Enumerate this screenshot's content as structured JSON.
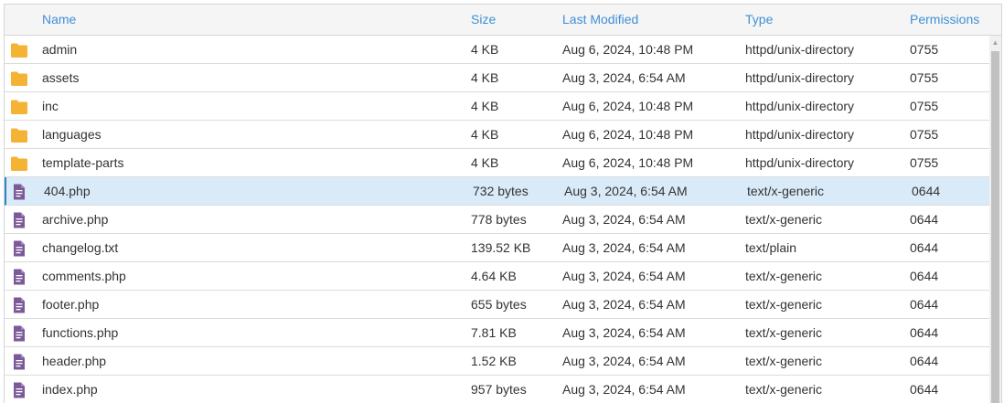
{
  "columns": {
    "name": "Name",
    "size": "Size",
    "modified": "Last Modified",
    "type": "Type",
    "permissions": "Permissions"
  },
  "colors": {
    "folder": "#f5b335",
    "file": "#7c5a9a",
    "header_text": "#3f8fd8",
    "selected_row": "#d9ebf8"
  },
  "files": [
    {
      "name": "admin",
      "size": "4 KB",
      "modified": "Aug 6, 2024, 10:48 PM",
      "type": "httpd/unix-directory",
      "permissions": "0755",
      "kind": "folder-icon"
    },
    {
      "name": "assets",
      "size": "4 KB",
      "modified": "Aug 3, 2024, 6:54 AM",
      "type": "httpd/unix-directory",
      "permissions": "0755",
      "kind": "folder-icon"
    },
    {
      "name": "inc",
      "size": "4 KB",
      "modified": "Aug 6, 2024, 10:48 PM",
      "type": "httpd/unix-directory",
      "permissions": "0755",
      "kind": "folder-icon"
    },
    {
      "name": "languages",
      "size": "4 KB",
      "modified": "Aug 6, 2024, 10:48 PM",
      "type": "httpd/unix-directory",
      "permissions": "0755",
      "kind": "folder-icon"
    },
    {
      "name": "template-parts",
      "size": "4 KB",
      "modified": "Aug 6, 2024, 10:48 PM",
      "type": "httpd/unix-directory",
      "permissions": "0755",
      "kind": "folder-icon"
    },
    {
      "name": "404.php",
      "size": "732 bytes",
      "modified": "Aug 3, 2024, 6:54 AM",
      "type": "text/x-generic",
      "permissions": "0644",
      "kind": "file-icon",
      "selected": true
    },
    {
      "name": "archive.php",
      "size": "778 bytes",
      "modified": "Aug 3, 2024, 6:54 AM",
      "type": "text/x-generic",
      "permissions": "0644",
      "kind": "file-icon"
    },
    {
      "name": "changelog.txt",
      "size": "139.52 KB",
      "modified": "Aug 3, 2024, 6:54 AM",
      "type": "text/plain",
      "permissions": "0644",
      "kind": "file-icon"
    },
    {
      "name": "comments.php",
      "size": "4.64 KB",
      "modified": "Aug 3, 2024, 6:54 AM",
      "type": "text/x-generic",
      "permissions": "0644",
      "kind": "file-icon"
    },
    {
      "name": "footer.php",
      "size": "655 bytes",
      "modified": "Aug 3, 2024, 6:54 AM",
      "type": "text/x-generic",
      "permissions": "0644",
      "kind": "file-icon"
    },
    {
      "name": "functions.php",
      "size": "7.81 KB",
      "modified": "Aug 3, 2024, 6:54 AM",
      "type": "text/x-generic",
      "permissions": "0644",
      "kind": "file-icon"
    },
    {
      "name": "header.php",
      "size": "1.52 KB",
      "modified": "Aug 3, 2024, 6:54 AM",
      "type": "text/x-generic",
      "permissions": "0644",
      "kind": "file-icon"
    },
    {
      "name": "index.php",
      "size": "957 bytes",
      "modified": "Aug 3, 2024, 6:54 AM",
      "type": "text/x-generic",
      "permissions": "0644",
      "kind": "file-icon"
    }
  ]
}
